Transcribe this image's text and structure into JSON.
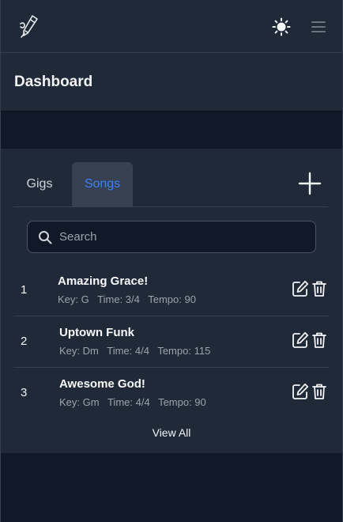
{
  "header": {
    "title": "Dashboard"
  },
  "tabs": [
    {
      "label": "Gigs",
      "active": false
    },
    {
      "label": "Songs",
      "active": true
    }
  ],
  "search": {
    "placeholder": "Search",
    "value": ""
  },
  "songs": [
    {
      "number": "1",
      "title": "Amazing Grace!",
      "key": "Key: G",
      "time": "Time: 3/4",
      "tempo": "Tempo: 90"
    },
    {
      "number": "2",
      "title": "Uptown Funk",
      "key": "Key: Dm",
      "time": "Time: 4/4",
      "tempo": "Tempo: 115"
    },
    {
      "number": "3",
      "title": "Awesome God!",
      "key": "Key: Gm",
      "time": "Time: 4/4",
      "tempo": "Tempo: 90"
    }
  ],
  "footer": {
    "view_all": "View All"
  },
  "icons": {
    "logo": "pen-nib-guitar-icon",
    "theme": "sun-icon",
    "menu": "hamburger-menu-icon",
    "add": "plus-icon",
    "search": "search-icon",
    "edit": "pencil-square-icon",
    "delete": "trash-icon"
  },
  "colors": {
    "background": "#111827",
    "surface": "#1f2937",
    "border": "#374151",
    "accent": "#3b82f6",
    "muted_text": "#9ca3af"
  }
}
